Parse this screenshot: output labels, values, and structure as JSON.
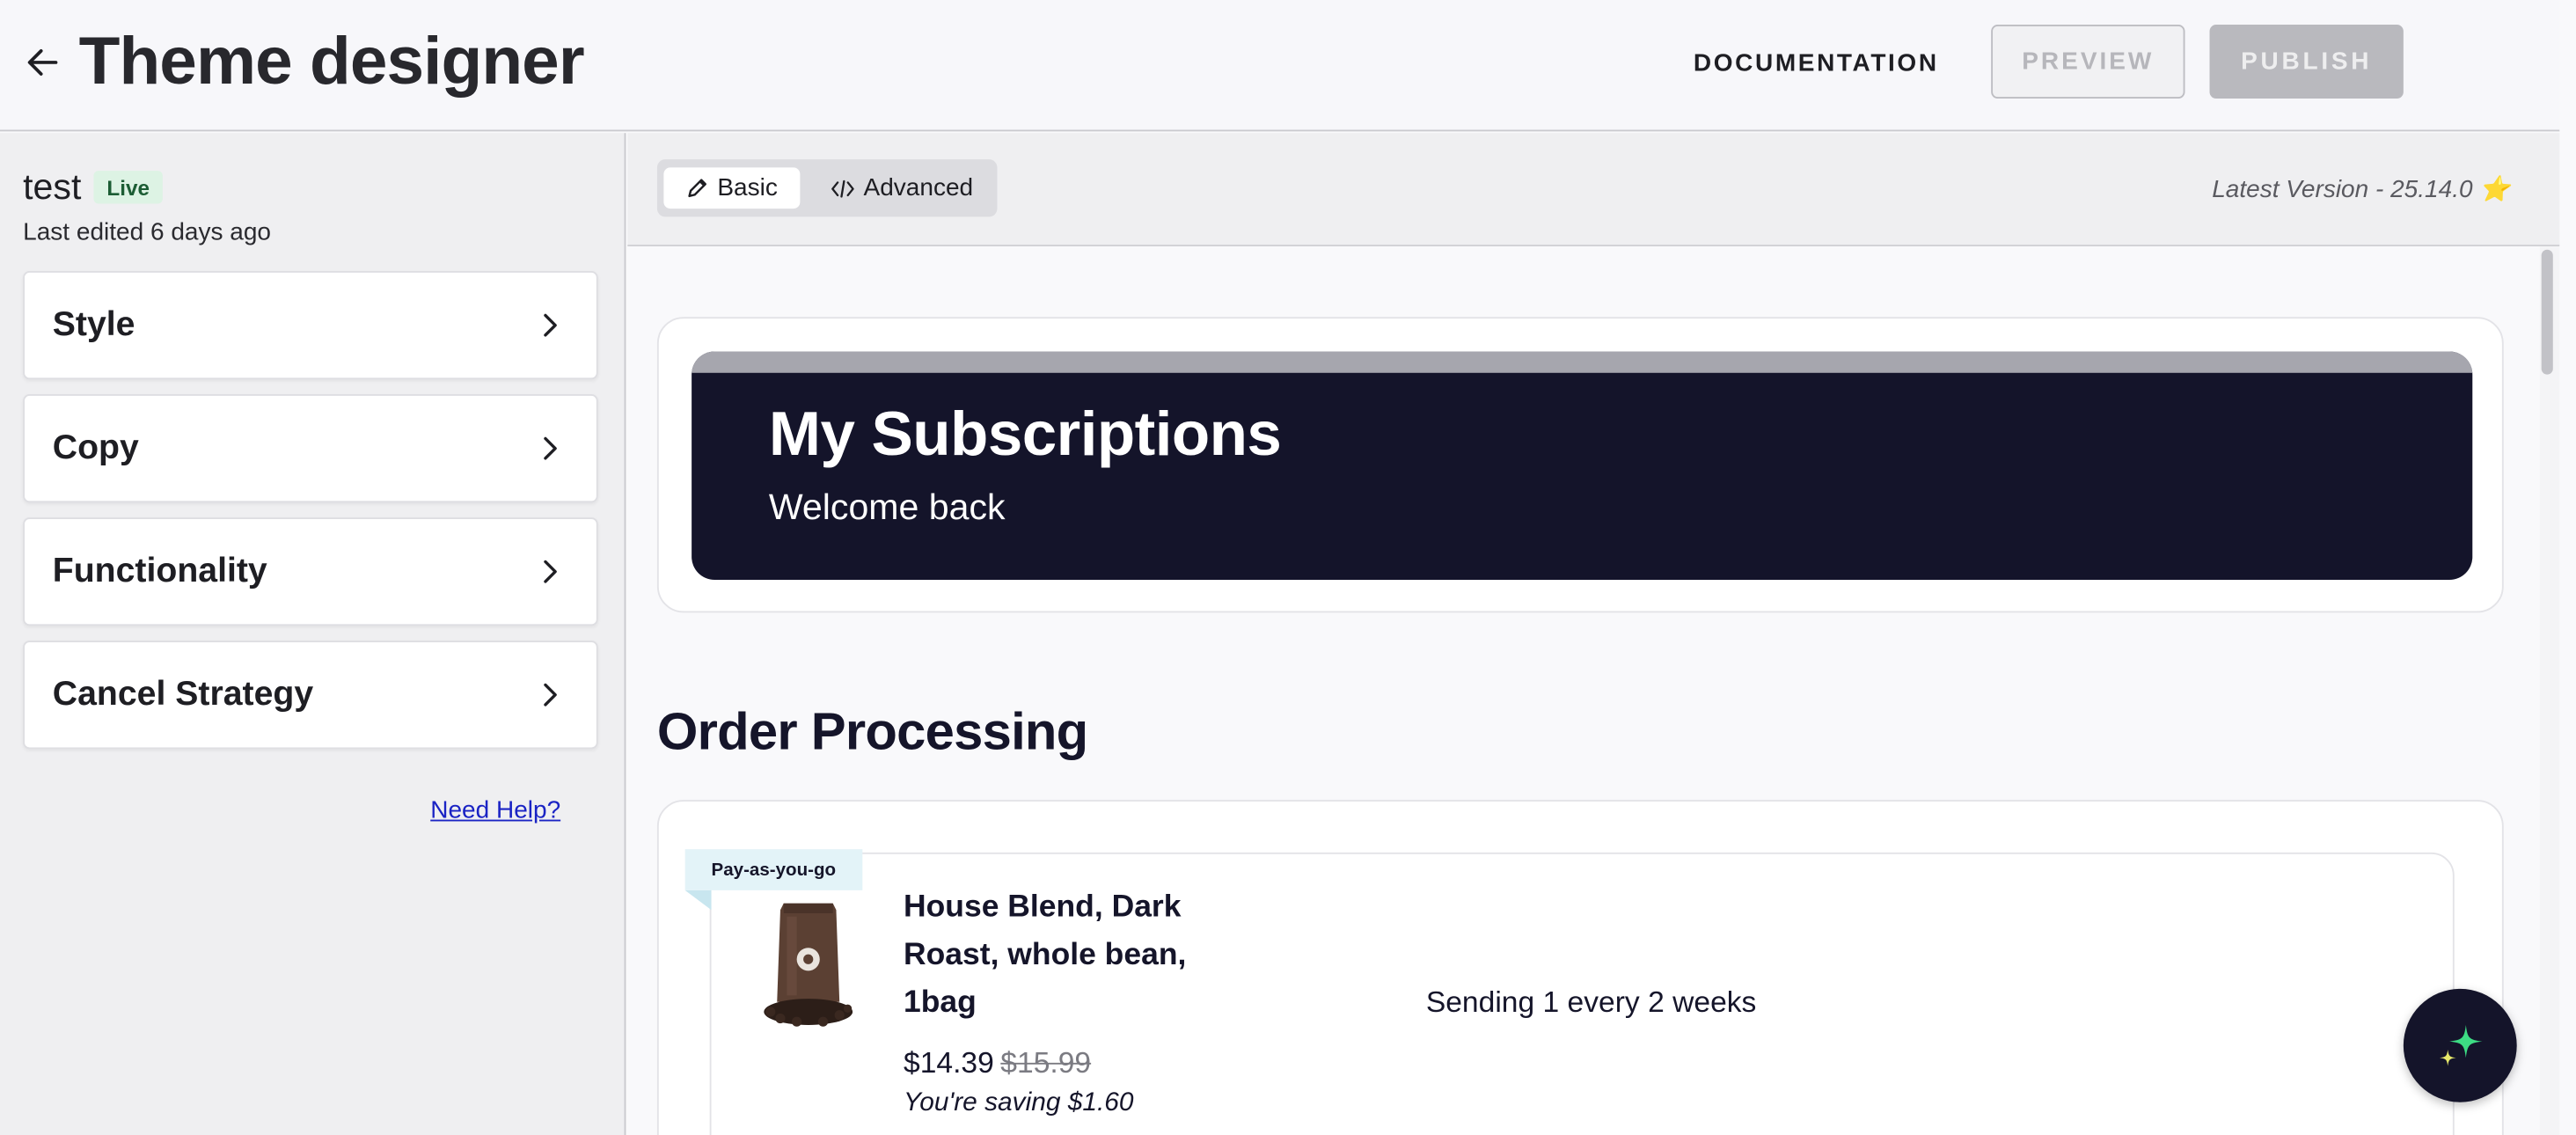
{
  "header": {
    "title": "Theme designer",
    "documentation_label": "DOCUMENTATION",
    "preview_label": "PREVIEW",
    "publish_label": "PUBLISH"
  },
  "sidebar": {
    "theme_name": "test",
    "status_badge": "Live",
    "last_edited": "Last edited 6 days ago",
    "items": [
      {
        "label": "Style"
      },
      {
        "label": "Copy"
      },
      {
        "label": "Functionality"
      },
      {
        "label": "Cancel Strategy"
      }
    ],
    "help_link": "Need Help?"
  },
  "editor": {
    "modes": [
      {
        "label": "Basic",
        "icon": "pencil-icon",
        "selected": true
      },
      {
        "label": "Advanced",
        "icon": "code-icon",
        "selected": false
      }
    ],
    "version": "Latest Version - 25.14.0 ⭐"
  },
  "preview": {
    "hero_title": "My Subscriptions",
    "hero_subtitle": "Welcome back",
    "section_title": "Order Processing",
    "subscription": {
      "badge": "Pay-as-you-go",
      "product_name": "House Blend, Dark Roast, whole bean, 1bag",
      "price": "$14.39",
      "original_price": "$15.99",
      "saving": "You're saving $1.60",
      "frequency": "Sending 1 every 2 weeks"
    }
  },
  "colors": {
    "hero_bg": "#14142a",
    "badge_bg": "#ddf3e4",
    "link": "#1a23c4",
    "sparkle_green": "#3ddc84",
    "sparkle_yellow": "#e6e86a"
  },
  "fab": {
    "icon": "sparkles-icon"
  }
}
